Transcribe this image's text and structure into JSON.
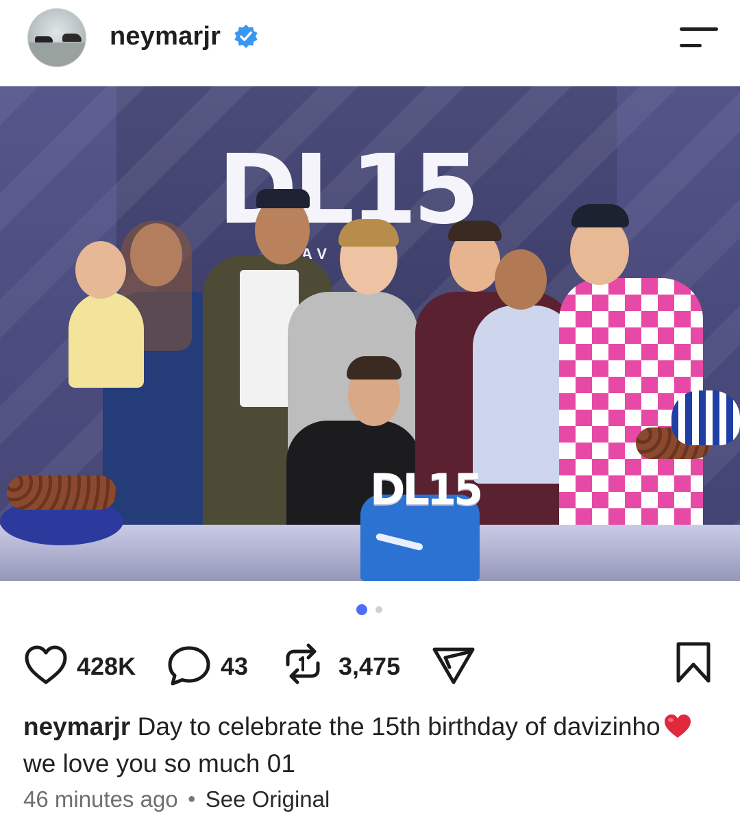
{
  "header": {
    "username": "neymarjr",
    "avatar_icon": "profile-avatar",
    "verified_icon": "verified-badge-icon",
    "verified_color": "#3897f0",
    "menu_icon": "menu-icon"
  },
  "post": {
    "image_icon": "post-photo",
    "wall_logo": "DL15",
    "wall_subtitle": "AV   CA",
    "cake_topper": "DL15",
    "carousel": {
      "total": 2,
      "active": 1,
      "active_color": "#4f6ef7",
      "inactive_color": "#d0d0d0"
    }
  },
  "actions": {
    "like_count": "428K",
    "comment_count": "43",
    "repost_count": "3,475",
    "like_icon": "heart-icon",
    "comment_icon": "comment-icon",
    "repost_icon": "repost-icon",
    "share_icon": "share-icon",
    "save_icon": "bookmark-icon"
  },
  "caption": {
    "username": "neymarjr",
    "text_before": "Day to celebrate the 15th birthday of davizinho",
    "emoji": "red-heart",
    "text_after": "we love you so much 01"
  },
  "meta": {
    "time": "46 minutes ago",
    "see_original": "See Original"
  }
}
